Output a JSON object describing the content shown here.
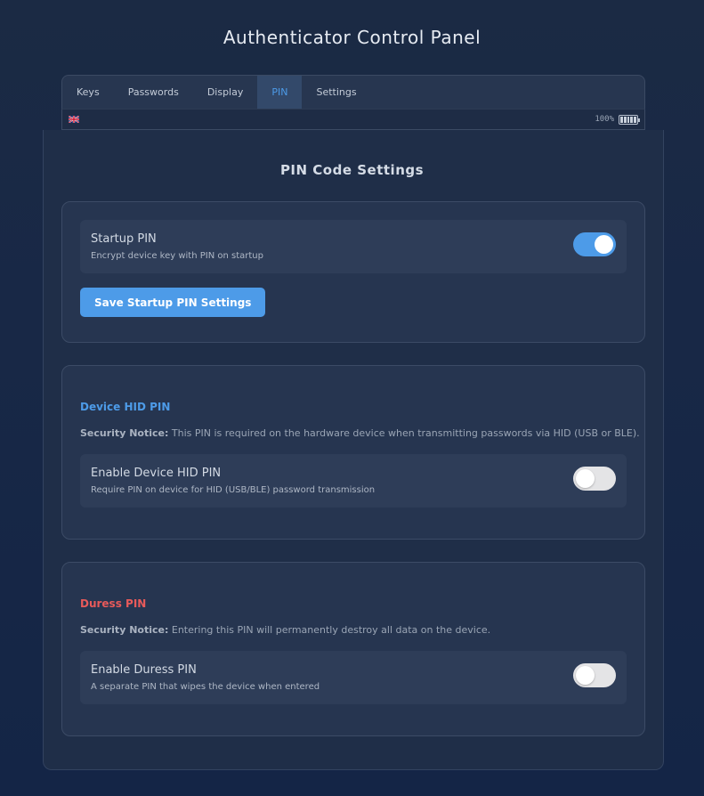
{
  "app": {
    "title": "Authenticator Control Panel"
  },
  "tabs": [
    {
      "label": "Keys",
      "active": false
    },
    {
      "label": "Passwords",
      "active": false
    },
    {
      "label": "Display",
      "active": false
    },
    {
      "label": "PIN",
      "active": true
    },
    {
      "label": "Settings",
      "active": false
    }
  ],
  "status": {
    "language_icon": "uk-flag-icon",
    "battery_text": "100%",
    "battery_icon": "battery-full-icon"
  },
  "page": {
    "title": "PIN Code Settings"
  },
  "startup_pin": {
    "label": "Startup PIN",
    "description": "Encrypt device key with PIN on startup",
    "enabled": true,
    "save_button": "Save Startup PIN Settings"
  },
  "device_hid_pin": {
    "heading": "Device HID PIN",
    "notice_label": "Security Notice:",
    "notice_text": "This PIN is required on the hardware device when transmitting passwords via HID (USB or BLE).",
    "toggle_label": "Enable Device HID PIN",
    "toggle_description": "Require PIN on device for HID (USB/BLE) password transmission",
    "enabled": false
  },
  "duress_pin": {
    "heading": "Duress PIN",
    "notice_label": "Security Notice:",
    "notice_text": "Entering this PIN will permanently destroy all data on the device.",
    "toggle_label": "Enable Duress PIN",
    "toggle_description": "A separate PIN that wipes the device when entered",
    "enabled": false
  },
  "colors": {
    "accent": "#4d9be8",
    "hid_heading": "#4d9be8",
    "duress_heading": "#e85a5a"
  }
}
